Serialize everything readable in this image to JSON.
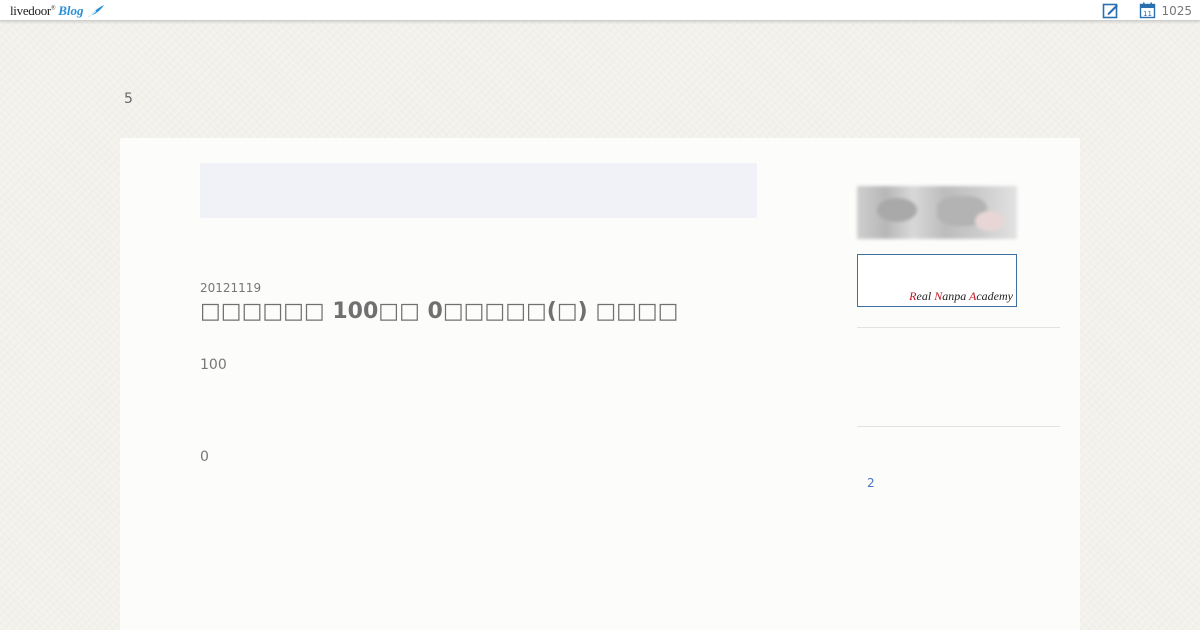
{
  "topbar": {
    "logo_word": "livedoor",
    "logo_tm": "®",
    "logo_blog": "Blog",
    "edit_icon": "edit-icon",
    "calendar_icon": "calendar-icon",
    "calendar_day": "11",
    "count": "1025"
  },
  "header": {
    "number": "5"
  },
  "post": {
    "date": "20121119",
    "title": "□□□□□□ 100□□ 0□□□□□(□) □□□□",
    "line1": "100",
    "line2": "0"
  },
  "sidebar": {
    "banner_text": {
      "r": "R",
      "eal": "eal ",
      "n": "N",
      "anpa": "anpa ",
      "a": "A",
      "cademy": "cademy"
    },
    "link": "2"
  },
  "colors": {
    "accent_blue": "#2a8fd6",
    "banner_border": "#3f6ea3",
    "banner_red": "#c0121e",
    "link": "#4a76c4"
  }
}
